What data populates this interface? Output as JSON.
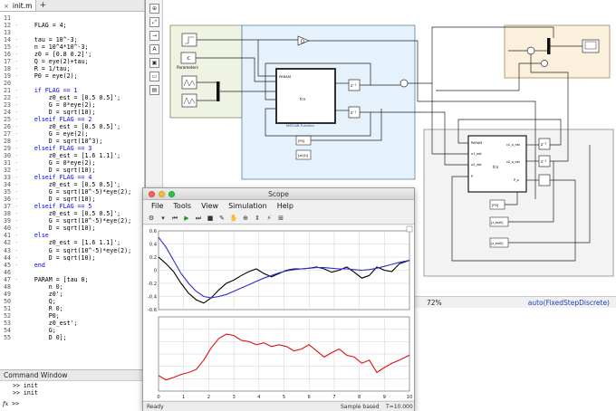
{
  "editor": {
    "tab_label": "init.m",
    "tab_close": "×",
    "tab_add": "+",
    "lines": [
      {
        "n": "11",
        "d": "",
        "t": ""
      },
      {
        "n": "12",
        "d": "-",
        "t": "    FLAG = 4;"
      },
      {
        "n": "13",
        "d": "",
        "t": ""
      },
      {
        "n": "14",
        "d": "-",
        "t": "    tau = 10^-3;"
      },
      {
        "n": "15",
        "d": "-",
        "t": "    n = 10^4*10^-3;"
      },
      {
        "n": "16",
        "d": "-",
        "t": "    z0 = [0.8 0.2]';"
      },
      {
        "n": "17",
        "d": "-",
        "t": "    Q = eye(2)+tau;"
      },
      {
        "n": "18",
        "d": "-",
        "t": "    R = 1/tau;"
      },
      {
        "n": "19",
        "d": "-",
        "t": "    P0 = eye(2);"
      },
      {
        "n": "20",
        "d": "",
        "t": ""
      },
      {
        "n": "21",
        "d": "-",
        "t": "    if FLAG == 1",
        "k": true
      },
      {
        "n": "22",
        "d": "-",
        "t": "        z0_est = [0.5 0.5]';"
      },
      {
        "n": "23",
        "d": "-",
        "t": "        G = 0*eye(2);"
      },
      {
        "n": "24",
        "d": "-",
        "t": "        D = sqrt(10);"
      },
      {
        "n": "25",
        "d": "-",
        "t": "    elseif FLAG == 2",
        "k": true
      },
      {
        "n": "26",
        "d": "-",
        "t": "        z0_est = [0.5 0.5]';"
      },
      {
        "n": "27",
        "d": "-",
        "t": "        G = eye(2);"
      },
      {
        "n": "28",
        "d": "-",
        "t": "        D = sqrt(10^3);"
      },
      {
        "n": "29",
        "d": "-",
        "t": "    elseif FLAG == 3",
        "k": true
      },
      {
        "n": "30",
        "d": "-",
        "t": "        z0_est = [1.6 1.1]';"
      },
      {
        "n": "31",
        "d": "-",
        "t": "        G = 0*eye(2);"
      },
      {
        "n": "32",
        "d": "-",
        "t": "        D = sqrt(10);"
      },
      {
        "n": "33",
        "d": "-",
        "t": "    elseif FLAG == 4",
        "k": true
      },
      {
        "n": "34",
        "d": "-",
        "t": "        z0_est = [0.5 0.5]';"
      },
      {
        "n": "35",
        "d": "-",
        "t": "        G = sqrt(10^-5)*eye(2);"
      },
      {
        "n": "36",
        "d": "-",
        "t": "        D = sqrt(10);"
      },
      {
        "n": "37",
        "d": "-",
        "t": "    elseif FLAG == 5",
        "k": true
      },
      {
        "n": "38",
        "d": "-",
        "t": "        z0_est = [0.5 0.5]';"
      },
      {
        "n": "39",
        "d": "-",
        "t": "        G = sqrt(10^-5)*eye(2);"
      },
      {
        "n": "40",
        "d": "-",
        "t": "        D = sqrt(10);"
      },
      {
        "n": "41",
        "d": "-",
        "t": "    else",
        "k": true
      },
      {
        "n": "42",
        "d": "-",
        "t": "        z0_est = [1.6 1.1]';"
      },
      {
        "n": "43",
        "d": "-",
        "t": "        G = sqrt(10^-5)*eye(2);"
      },
      {
        "n": "44",
        "d": "-",
        "t": "        D = sqrt(10);"
      },
      {
        "n": "45",
        "d": "-",
        "t": "    end",
        "k": true
      },
      {
        "n": "46",
        "d": "",
        "t": ""
      },
      {
        "n": "47",
        "d": "-",
        "t": "    PARAM = [tau 0;"
      },
      {
        "n": "48",
        "d": "",
        "t": "        n 0;"
      },
      {
        "n": "49",
        "d": "",
        "t": "        z0';"
      },
      {
        "n": "50",
        "d": "",
        "t": "        Q;"
      },
      {
        "n": "51",
        "d": "",
        "t": "        R 0;"
      },
      {
        "n": "52",
        "d": "",
        "t": "        P0;"
      },
      {
        "n": "53",
        "d": "",
        "t": "        z0_est';"
      },
      {
        "n": "54",
        "d": "",
        "t": "        G;"
      },
      {
        "n": "55",
        "d": "",
        "t": "        D 0];"
      }
    ]
  },
  "command_window": {
    "title": "Command Window",
    "history": [
      ">> init",
      ">> init"
    ],
    "prompt_fx": "fx",
    "prompt": ">>"
  },
  "simulink": {
    "zoom": "72%",
    "solver": "auto(FixedStepDiscrete)",
    "toolbar_icons": [
      "zoom-in-icon",
      "fit-view-icon",
      "arrow-icon",
      "annotation-icon",
      "image-icon",
      "area-icon",
      "panel-icon"
    ],
    "labels": {
      "params": "Parameters",
      "param_in": "PARAM",
      "fcn": "fcn",
      "fcn_name": "MATLAB Function",
      "delay": "z⁻¹",
      "gain": "D",
      "p0_a": "[P0]",
      "p0_b": "[z0(t)]",
      "fcn2_in_a": "PARAM",
      "fcn2_in_b": "x1_est",
      "fcn2_in_c": "x2_est",
      "fcn2_in_d": "P",
      "fcn2_fcn": "fcn",
      "p0_c": "[P0]",
      "z_est_a": "[z_est0]",
      "z_est_b": "[z_est0]",
      "x1_out": "x1_o_est",
      "x2_out": "x2_o_est",
      "p_out": "P_o",
      "y1": "x1_o",
      "y2": "x2_o"
    }
  },
  "scope": {
    "title": "Scope",
    "menu": [
      "File",
      "Tools",
      "View",
      "Simulation",
      "Help"
    ],
    "status_left": "Ready",
    "status_mid": "Sample based",
    "status_right": "T=10.000",
    "colors": {
      "black": "#000000",
      "blue": "#2b2bd8",
      "red": "#e01010"
    }
  },
  "chart_data": [
    {
      "type": "line",
      "ylim": [
        -0.6,
        0.6
      ],
      "y_ticks": [
        "0.6",
        "0.4",
        "0.2",
        "0",
        "-0.2",
        "-0.4",
        "-0.6"
      ],
      "xlim": [
        0,
        10
      ],
      "series": [
        {
          "color": "#000000",
          "x": [
            0,
            0.3,
            0.6,
            0.9,
            1.2,
            1.5,
            1.8,
            2.1,
            2.4,
            2.7,
            3.0,
            3.3,
            3.6,
            3.9,
            4.2,
            4.5,
            4.8,
            5.1,
            5.4,
            5.7,
            6.0,
            6.3,
            6.6,
            6.9,
            7.2,
            7.5,
            7.8,
            8.1,
            8.4,
            8.7,
            9.0,
            9.3,
            9.6,
            10.0
          ],
          "values": [
            0.2,
            0.1,
            -0.02,
            -0.2,
            -0.35,
            -0.45,
            -0.5,
            -0.42,
            -0.3,
            -0.2,
            -0.15,
            -0.08,
            -0.02,
            0.02,
            -0.05,
            -0.1,
            -0.05,
            0.0,
            0.02,
            0.02,
            0.03,
            0.05,
            0.02,
            -0.03,
            0.0,
            0.05,
            -0.03,
            -0.12,
            -0.08,
            0.05,
            0.0,
            -0.02,
            0.1,
            0.15
          ]
        },
        {
          "color": "#2b2bd8",
          "x": [
            0,
            0.3,
            0.6,
            0.9,
            1.2,
            1.5,
            1.8,
            2.1,
            2.4,
            2.7,
            3.0,
            3.3,
            3.6,
            3.9,
            4.2,
            4.5,
            4.8,
            5.1,
            5.4,
            5.7,
            6.0,
            6.3,
            6.6,
            6.9,
            7.2,
            7.5,
            7.8,
            8.1,
            8.4,
            8.7,
            9.0,
            9.3,
            9.6,
            10.0
          ],
          "values": [
            0.5,
            0.35,
            0.15,
            -0.05,
            -0.2,
            -0.32,
            -0.4,
            -0.42,
            -0.4,
            -0.37,
            -0.32,
            -0.27,
            -0.22,
            -0.17,
            -0.12,
            -0.08,
            -0.04,
            -0.01,
            0.01,
            0.02,
            0.03,
            0.04,
            0.04,
            0.03,
            0.02,
            0.02,
            0.01,
            0.0,
            0.01,
            0.03,
            0.06,
            0.09,
            0.12,
            0.15
          ]
        }
      ]
    },
    {
      "type": "line",
      "ylim": [
        -0.6,
        0.6
      ],
      "xlim": [
        0,
        10
      ],
      "x_ticks": [
        "0",
        "1",
        "2",
        "3",
        "4",
        "5",
        "6",
        "7",
        "8",
        "9",
        "10"
      ],
      "series": [
        {
          "color": "#e01010",
          "x": [
            0,
            0.3,
            0.6,
            0.9,
            1.2,
            1.5,
            1.8,
            2.1,
            2.4,
            2.7,
            3.0,
            3.3,
            3.6,
            3.9,
            4.2,
            4.5,
            4.8,
            5.1,
            5.4,
            5.7,
            6.0,
            6.3,
            6.6,
            6.9,
            7.2,
            7.5,
            7.8,
            8.1,
            8.4,
            8.7,
            9.0,
            9.3,
            9.6,
            10.0
          ],
          "values": [
            -0.35,
            -0.42,
            -0.38,
            -0.33,
            -0.3,
            -0.25,
            -0.1,
            0.1,
            0.25,
            0.32,
            0.3,
            0.22,
            0.2,
            0.15,
            0.18,
            0.12,
            0.15,
            0.12,
            0.05,
            0.08,
            0.15,
            0.05,
            -0.05,
            0.02,
            0.08,
            -0.02,
            -0.05,
            -0.15,
            -0.1,
            -0.3,
            -0.22,
            -0.15,
            -0.1,
            -0.02
          ]
        }
      ]
    }
  ]
}
